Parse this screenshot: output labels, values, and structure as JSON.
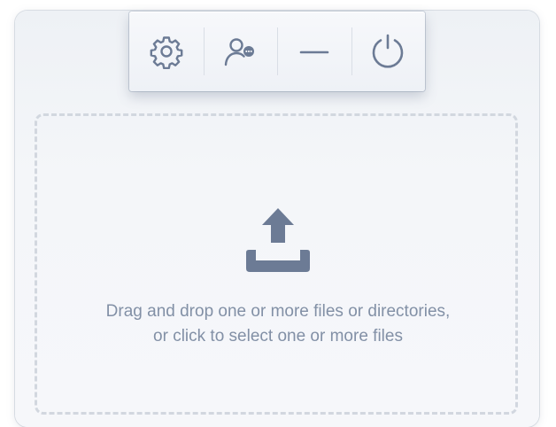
{
  "toolbar": {
    "buttons": [
      {
        "icon": "gear-icon",
        "color": "#6c7b95"
      },
      {
        "icon": "user-status-icon",
        "color": "#6c7b95"
      },
      {
        "icon": "minimize-icon",
        "color": "#6c7b95"
      },
      {
        "icon": "power-icon",
        "color": "#6c7b95"
      }
    ]
  },
  "dropzone": {
    "icon": "upload-icon",
    "line1": "Drag and drop one or more files or directories,",
    "line2": "or click to select one or more files",
    "icon_color": "#6c7b95",
    "text_color": "#8290a6",
    "border_color": "#d2d7df"
  }
}
